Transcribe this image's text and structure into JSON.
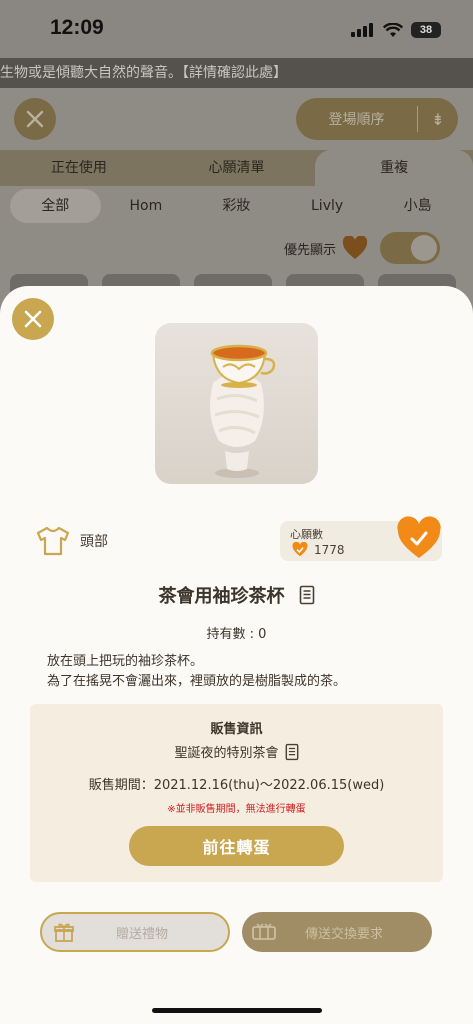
{
  "status_bar": {
    "time": "12:09",
    "battery": "38"
  },
  "marquee": {
    "text": "生物或是傾聽大自然的聲音。【詳情確認此處】"
  },
  "background": {
    "sort_label": "登場順序",
    "tabs": [
      "正在使用",
      "心願清單",
      "重複"
    ],
    "categories": [
      "全部",
      "Hom",
      "彩妝",
      "Livly",
      "小島"
    ],
    "priority_label": "優先顯示"
  },
  "item": {
    "category_label": "頭部",
    "name": "茶會用袖珍茶杯",
    "owned_text": "持有數 : 0",
    "description_lines": [
      "放在頭上把玩的袖珍茶杯。",
      "為了在搖晃不會灑出來，裡頭放的是樹脂製成的茶。"
    ],
    "wish": {
      "title": "心願數",
      "count": "1778"
    }
  },
  "sale": {
    "title": "販售資訊",
    "event": "聖誕夜的特別茶會",
    "period": "販售期間：2021.12.16(thu)～2022.06.15(wed)",
    "note": "※並非販售期間，無法進行轉蛋",
    "gacha_button": "前往轉蛋"
  },
  "actions": {
    "gift_button": "贈送禮物",
    "trade_button": "傳送交換要求"
  },
  "colors": {
    "accent": "#c9a650",
    "heart": "#f28a18",
    "warning": "#d21d1d"
  }
}
